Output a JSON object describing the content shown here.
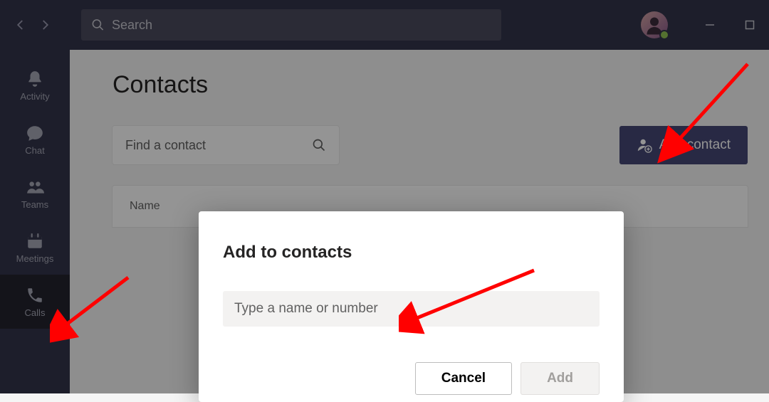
{
  "search": {
    "placeholder": "Search"
  },
  "rail": {
    "items": [
      {
        "label": "Activity"
      },
      {
        "label": "Chat"
      },
      {
        "label": "Teams"
      },
      {
        "label": "Meetings"
      },
      {
        "label": "Calls"
      }
    ]
  },
  "page": {
    "title": "Contacts",
    "find_placeholder": "Find a contact",
    "add_contact_label": "Add contact",
    "table": {
      "col_name": "Name"
    }
  },
  "modal": {
    "title": "Add to contacts",
    "input_placeholder": "Type a name or number",
    "cancel_label": "Cancel",
    "add_label": "Add"
  }
}
